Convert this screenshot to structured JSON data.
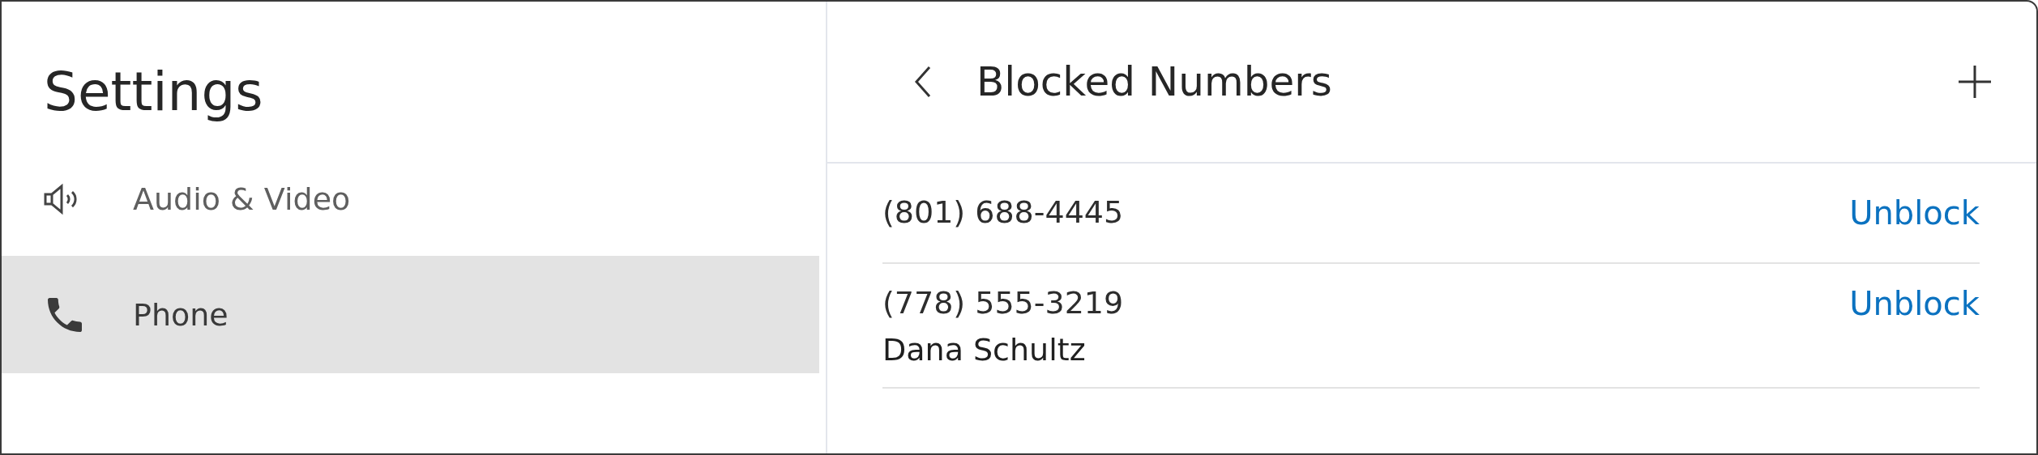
{
  "sidebar": {
    "title": "Settings",
    "items": [
      {
        "kind": "speaker",
        "label": "Audio & Video",
        "selected": false
      },
      {
        "kind": "phone",
        "label": "Phone",
        "selected": true
      }
    ]
  },
  "panel": {
    "title": "Blocked Numbers",
    "entries": [
      {
        "number": "(801) 688-4445",
        "action": "Unblock"
      },
      {
        "number": "(778) 555-3219",
        "name": "Dana Schultz",
        "action": "Unblock"
      }
    ]
  }
}
